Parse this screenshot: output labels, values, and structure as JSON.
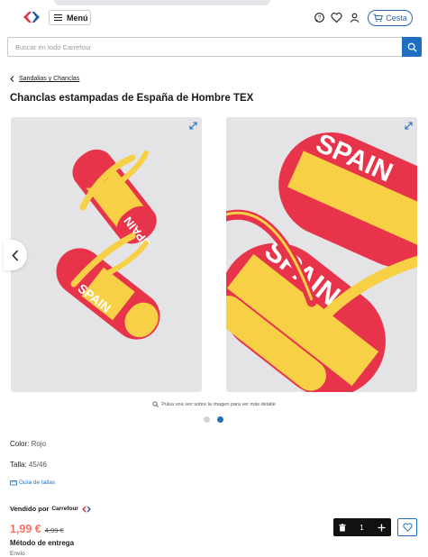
{
  "header": {
    "menu_label": "Menú",
    "cart_label": "Cesta"
  },
  "search": {
    "placeholder": "Buscar en todo Carrefour"
  },
  "breadcrumb": {
    "back_label": "Sandalias y Chanclas"
  },
  "product": {
    "title": "Chanclas estampadas de España de Hombre TEX",
    "image_text": "SPAIN",
    "zoom_hint": "Pulsa una vez sobre la imagen para ver más detalle",
    "color_label": "Color:",
    "color_value": "Rojo",
    "size_label": "Talla:",
    "size_value": "45/46",
    "size_guide_label": "Guía de tallas",
    "sold_by_label": "Vendido por",
    "seller_name": "Carrefour",
    "price": "1,99 €",
    "old_price": "4,99 €",
    "quantity": "1",
    "delivery_title": "Método de entrega",
    "delivery_sub": "Envío"
  },
  "colors": {
    "accent_blue": "#1e6fbf",
    "price_red": "#ff6f61",
    "flag_red": "#e8344a",
    "flag_yellow": "#f7d046"
  }
}
